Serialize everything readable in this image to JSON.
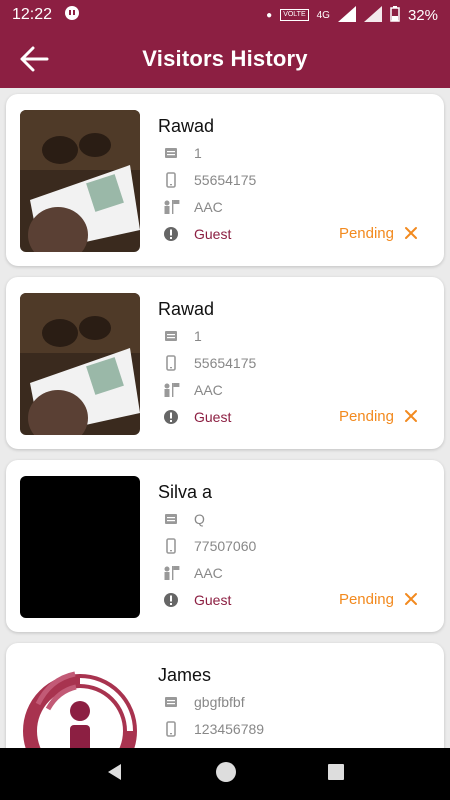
{
  "status_bar": {
    "time": "12:22",
    "volte": "VOLTE",
    "network": "4G",
    "battery": "32%"
  },
  "header": {
    "title": "Visitors History"
  },
  "visitors": [
    {
      "name": "Rawad",
      "id_value": "1",
      "phone": "55654175",
      "company": "AAC",
      "type": "Guest",
      "status": "Pending"
    },
    {
      "name": "Rawad",
      "id_value": "1",
      "phone": "55654175",
      "company": "AAC",
      "type": "Guest",
      "status": "Pending"
    },
    {
      "name": "Silva a",
      "id_value": "Q",
      "phone": "77507060",
      "company": "AAC",
      "type": "Guest",
      "status": "Pending"
    },
    {
      "name": "James",
      "id_value": "gbgfbfbf",
      "phone": "123456789"
    }
  ],
  "colors": {
    "brand": "#8c1f42",
    "pending": "#f28a1f"
  },
  "icons": {
    "back": "arrow-left-icon",
    "id": "id-card-icon",
    "phone": "phone-icon",
    "company": "person-flag-icon",
    "type": "info-icon",
    "cancel": "close-icon"
  }
}
